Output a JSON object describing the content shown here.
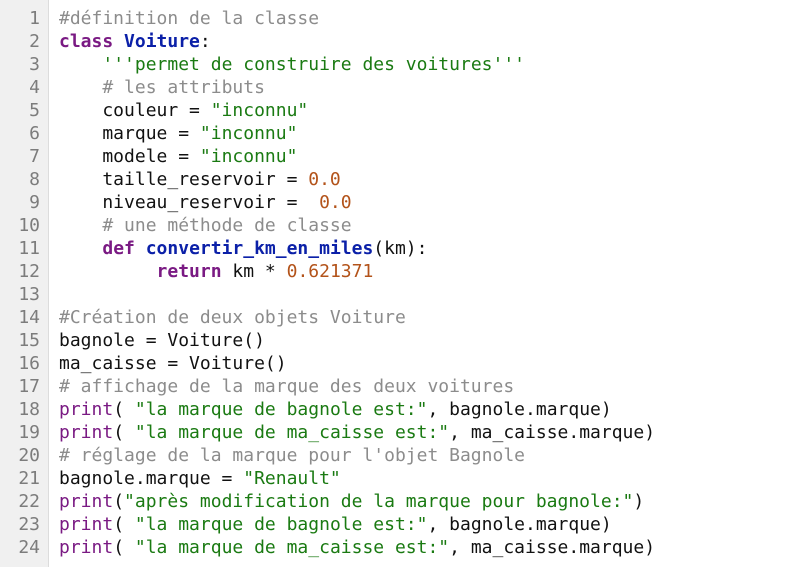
{
  "editor": {
    "language": "python",
    "colors": {
      "keyword": "#7a1a83",
      "definition_name": "#0b20a8",
      "string": "#1a7a12",
      "comment": "#8c8c8c",
      "number": "#b3531a",
      "builtin": "#7a1a83",
      "gutter_background": "#f0f0f0",
      "line_number": "#7c7c7c"
    },
    "lines": [
      {
        "n": "1",
        "tokens": [
          {
            "t": "cmt",
            "v": "#définition de la classe"
          }
        ]
      },
      {
        "n": "2",
        "tokens": [
          {
            "t": "kw",
            "v": "class"
          },
          {
            "t": "op",
            "v": " "
          },
          {
            "t": "def",
            "v": "Voiture"
          },
          {
            "t": "op",
            "v": ":"
          }
        ]
      },
      {
        "n": "3",
        "tokens": [
          {
            "t": "op",
            "v": "    "
          },
          {
            "t": "str",
            "v": "'''permet de construire des voitures'''"
          }
        ]
      },
      {
        "n": "4",
        "tokens": [
          {
            "t": "op",
            "v": "    "
          },
          {
            "t": "cmt",
            "v": "# les attributs"
          }
        ]
      },
      {
        "n": "5",
        "tokens": [
          {
            "t": "id",
            "v": "    couleur = "
          },
          {
            "t": "str",
            "v": "\"inconnu\""
          }
        ]
      },
      {
        "n": "6",
        "tokens": [
          {
            "t": "id",
            "v": "    marque = "
          },
          {
            "t": "str",
            "v": "\"inconnu\""
          }
        ]
      },
      {
        "n": "7",
        "tokens": [
          {
            "t": "id",
            "v": "    modele = "
          },
          {
            "t": "str",
            "v": "\"inconnu\""
          }
        ]
      },
      {
        "n": "8",
        "tokens": [
          {
            "t": "id",
            "v": "    taille_reservoir = "
          },
          {
            "t": "num",
            "v": "0.0"
          }
        ]
      },
      {
        "n": "9",
        "tokens": [
          {
            "t": "id",
            "v": "    niveau_reservoir =  "
          },
          {
            "t": "num",
            "v": "0.0"
          }
        ]
      },
      {
        "n": "10",
        "tokens": [
          {
            "t": "op",
            "v": "    "
          },
          {
            "t": "cmt",
            "v": "# une méthode de classe"
          }
        ]
      },
      {
        "n": "11",
        "tokens": [
          {
            "t": "op",
            "v": "    "
          },
          {
            "t": "kw",
            "v": "def"
          },
          {
            "t": "op",
            "v": " "
          },
          {
            "t": "def",
            "v": "convertir_km_en_miles"
          },
          {
            "t": "id",
            "v": "(km):"
          }
        ]
      },
      {
        "n": "12",
        "tokens": [
          {
            "t": "op",
            "v": "         "
          },
          {
            "t": "kw",
            "v": "return"
          },
          {
            "t": "id",
            "v": " km * "
          },
          {
            "t": "num",
            "v": "0.621371"
          }
        ]
      },
      {
        "n": "13",
        "tokens": []
      },
      {
        "n": "14",
        "tokens": [
          {
            "t": "cmt",
            "v": "#Création de deux objets Voiture"
          }
        ]
      },
      {
        "n": "15",
        "tokens": [
          {
            "t": "id",
            "v": "bagnole = Voiture()"
          }
        ]
      },
      {
        "n": "16",
        "tokens": [
          {
            "t": "id",
            "v": "ma_caisse = Voiture()"
          }
        ]
      },
      {
        "n": "17",
        "tokens": [
          {
            "t": "cmt",
            "v": "# affichage de la marque des deux voitures"
          }
        ]
      },
      {
        "n": "18",
        "tokens": [
          {
            "t": "fn",
            "v": "print"
          },
          {
            "t": "id",
            "v": "( "
          },
          {
            "t": "str",
            "v": "\"la marque de bagnole est:\""
          },
          {
            "t": "id",
            "v": ", bagnole.marque)"
          }
        ]
      },
      {
        "n": "19",
        "tokens": [
          {
            "t": "fn",
            "v": "print"
          },
          {
            "t": "id",
            "v": "( "
          },
          {
            "t": "str",
            "v": "\"la marque de ma_caisse est:\""
          },
          {
            "t": "id",
            "v": ", ma_caisse.marque)"
          }
        ]
      },
      {
        "n": "20",
        "tokens": [
          {
            "t": "cmt",
            "v": "# réglage de la marque pour l'objet Bagnole"
          }
        ]
      },
      {
        "n": "21",
        "tokens": [
          {
            "t": "id",
            "v": "bagnole.marque = "
          },
          {
            "t": "str",
            "v": "\"Renault\""
          }
        ]
      },
      {
        "n": "22",
        "tokens": [
          {
            "t": "fn",
            "v": "print"
          },
          {
            "t": "id",
            "v": "("
          },
          {
            "t": "str",
            "v": "\"après modification de la marque pour bagnole:\""
          },
          {
            "t": "id",
            "v": ")"
          }
        ]
      },
      {
        "n": "23",
        "tokens": [
          {
            "t": "fn",
            "v": "print"
          },
          {
            "t": "id",
            "v": "( "
          },
          {
            "t": "str",
            "v": "\"la marque de bagnole est:\""
          },
          {
            "t": "id",
            "v": ", bagnole.marque)"
          }
        ]
      },
      {
        "n": "24",
        "tokens": [
          {
            "t": "fn",
            "v": "print"
          },
          {
            "t": "id",
            "v": "( "
          },
          {
            "t": "str",
            "v": "\"la marque de ma_caisse est:\""
          },
          {
            "t": "id",
            "v": ", ma_caisse.marque)"
          }
        ]
      }
    ]
  }
}
